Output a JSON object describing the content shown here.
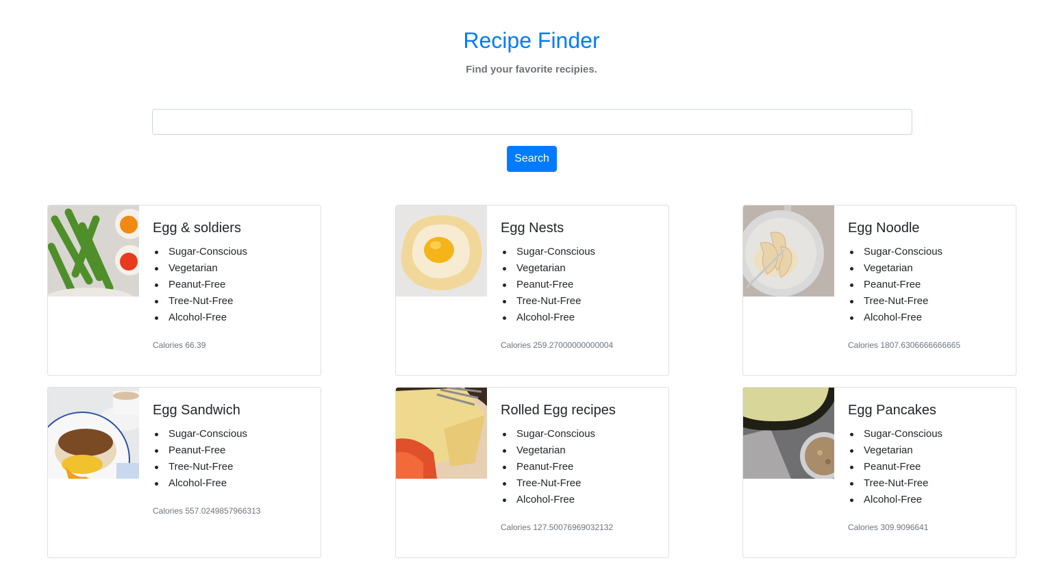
{
  "header": {
    "title": "Recipe Finder",
    "subtitle": "Find your favorite recipies."
  },
  "search": {
    "value": "",
    "placeholder": "",
    "button_label": "Search"
  },
  "colors": {
    "accent": "#007bff",
    "muted": "#6c757d",
    "text": "#212529",
    "border": "#dfdfdf"
  },
  "recipes": [
    {
      "title": "Egg & soldiers",
      "image": "egg-and-asparagus-photo",
      "labels": [
        "Sugar-Conscious",
        "Vegetarian",
        "Peanut-Free",
        "Tree-Nut-Free",
        "Alcohol-Free"
      ],
      "calories_label": "Calories",
      "calories": "66.39"
    },
    {
      "title": "Egg Nests",
      "image": "egg-nest-photo",
      "labels": [
        "Sugar-Conscious",
        "Vegetarian",
        "Peanut-Free",
        "Tree-Nut-Free",
        "Alcohol-Free"
      ],
      "calories_label": "Calories",
      "calories": "259.27000000000004"
    },
    {
      "title": "Egg Noodle",
      "image": "egg-noodle-photo",
      "labels": [
        "Sugar-Conscious",
        "Vegetarian",
        "Peanut-Free",
        "Tree-Nut-Free",
        "Alcohol-Free"
      ],
      "calories_label": "Calories",
      "calories": "1807.6306666666665"
    },
    {
      "title": "Egg Sandwich",
      "image": "egg-sandwich-photo",
      "labels": [
        "Sugar-Conscious",
        "Peanut-Free",
        "Tree-Nut-Free",
        "Alcohol-Free"
      ],
      "calories_label": "Calories",
      "calories": "557.0249857966313"
    },
    {
      "title": "Rolled Egg recipes",
      "image": "rolled-egg-photo",
      "labels": [
        "Sugar-Conscious",
        "Vegetarian",
        "Peanut-Free",
        "Tree-Nut-Free",
        "Alcohol-Free"
      ],
      "calories_label": "Calories",
      "calories": "127.50076969032132"
    },
    {
      "title": "Egg Pancakes",
      "image": "egg-pancakes-photo",
      "labels": [
        "Sugar-Conscious",
        "Vegetarian",
        "Peanut-Free",
        "Tree-Nut-Free",
        "Alcohol-Free"
      ],
      "calories_label": "Calories",
      "calories": "309.9096641"
    }
  ]
}
